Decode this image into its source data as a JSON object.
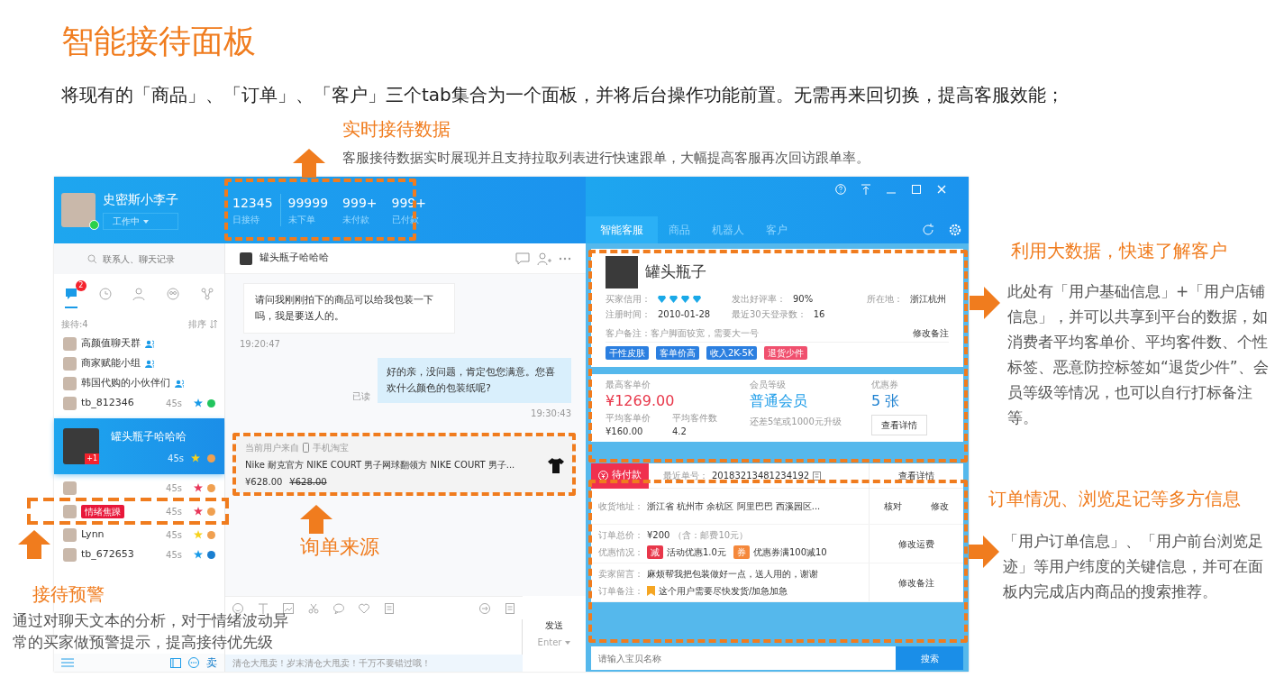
{
  "slide": {
    "title": "智能接待面板",
    "subtitle": "将现有的「商品」、「订单」、「客户」三个tab集合为一个面板，并将后台操作功能前置。无需再来回切换，提高客服效能；"
  },
  "annotations": [
    {
      "kind": "up",
      "heading": "实时接待数据",
      "text": "客服接待数据实时展现并且支持拉取列表进行快速跟单，大幅提高客服再次回访跟单率。"
    },
    {
      "kind": "right",
      "heading": "利用大数据，快速了解客户",
      "text": "此处有「用户基础信息」+「用户店铺信息」，并可以共享到平台的数据，如消费者平均客单价、平均客件数、个性标签、恶意防控标签如“退货少件”、会员等级等情况，也可以自行打标备注等。"
    },
    {
      "kind": "up",
      "heading": "接待预警",
      "text": "通过对聊天文本的分析，对于情绪波动异常的买家做预警提示，提高接待优先级"
    },
    {
      "kind": "up",
      "heading": "询单来源"
    },
    {
      "kind": "right",
      "heading": "订单情况、浏览足记等多方信息",
      "text": "「用户订单信息」、「用户前台浏览足迹」等用户纬度的关键信息，并可在面板内完成店内商品的搜索推荐。"
    }
  ],
  "agent": {
    "name": "史密斯小李子",
    "status": "工作中",
    "online": true
  },
  "stats": [
    {
      "value": "12345",
      "label": "日接待"
    },
    {
      "value": "99999",
      "label": "未下单"
    },
    {
      "value": "999+",
      "label": "未付款"
    },
    {
      "value": "999+",
      "label": "已付款"
    }
  ],
  "search": {
    "placeholder": "联系人、聊天记录"
  },
  "nav": [
    {
      "kind": "chat",
      "selected": true,
      "badge": "2"
    },
    {
      "kind": "recent",
      "selected": false
    },
    {
      "kind": "contact",
      "selected": false
    },
    {
      "kind": "group",
      "selected": false
    },
    {
      "kind": "share",
      "selected": false
    }
  ],
  "list_header": {
    "count": "接待:4",
    "sort": "排序"
  },
  "contacts": [
    {
      "kind": "group",
      "name": "高颜值聊天群",
      "selected": false
    },
    {
      "kind": "group",
      "name": "商家赋能小组",
      "selected": false
    },
    {
      "kind": "group",
      "name": "韩国代购的小伙伴们",
      "selected": false
    },
    {
      "kind": "person",
      "name": "tb_812346",
      "time": "45s",
      "star": {
        "color": "#1a9be8"
      },
      "status": {
        "color": "#22c55e"
      },
      "selected": false
    },
    {
      "kind": "person",
      "name": "罐头瓶子哈哈哈",
      "badge": "+1",
      "time": "45s",
      "star": {
        "color": "#f7d21c"
      },
      "status": {
        "color": "#f0a050"
      },
      "selected": true
    },
    {
      "kind": "person",
      "time": "45s",
      "star": {
        "color": "#e8375a"
      },
      "status": {
        "color": "#f0a050"
      },
      "selected": false
    },
    {
      "kind": "person",
      "tag": "情绪焦躁",
      "time": "45s",
      "star": {
        "color": "#e8375a"
      },
      "status": {
        "color": "#f0a050"
      },
      "selected": false
    },
    {
      "kind": "person",
      "name": "Lynn",
      "time": "45s",
      "star": {
        "color": "#f7d21c"
      },
      "status": {
        "color": "#f0a050"
      },
      "selected": false
    },
    {
      "kind": "person",
      "name": "tb_672653",
      "time": "45s",
      "star": {
        "color": "#1a9be8"
      },
      "status": {
        "color": "#1a7fd0"
      },
      "selected": false
    }
  ],
  "chat": {
    "name": "罐头瓶子哈哈哈",
    "messages": [
      {
        "kind": "incoming",
        "text": "请问我刚刚拍下的商品可以给我包装一下吗，我是要送人的。",
        "time": "19:20:47"
      },
      {
        "kind": "outgoing",
        "text": "好的亲，没问题，肯定包您满意。您喜欢什么颜色的包装纸呢?",
        "status": "已读",
        "time": "19:30:43"
      }
    ],
    "source": {
      "label": "当前用户来自",
      "channel": "手机淘宝",
      "product": "Nike 耐克官方 NIKE COURT 男子网球翻领方 NIKE COURT 男子...",
      "price": "¥628.00",
      "old_price": "¥628.00"
    },
    "send": "发送",
    "send_key": "Enter",
    "ticker": "清仓大甩卖！岁末清仓大甩卖！千万不要错过哦！"
  },
  "left_footer": {
    "shop": "卖"
  },
  "tabs": [
    {
      "label": "智能客服",
      "selected": true
    },
    {
      "label": "商品",
      "selected": false
    },
    {
      "label": "机器人",
      "selected": false
    },
    {
      "label": "客户",
      "selected": false
    }
  ],
  "customer": {
    "name": "罐头瓶子",
    "fields": [
      {
        "label": "买家信用：",
        "stars": 4
      },
      {
        "label": "发出好评率：",
        "value": "90%"
      },
      {
        "label": "所在地：",
        "value": "浙江杭州"
      },
      {
        "label": "注册时间：",
        "value": "2010-01-28"
      },
      {
        "label": "最近30天登录数：",
        "value": "16"
      }
    ],
    "note": "客户备注：客户脚面较宽，需要大一号",
    "note_button": "修改备注",
    "tags": [
      {
        "text": "干性皮肤",
        "color": "#2b7fe0"
      },
      {
        "text": "客单价高",
        "color": "#2b7fe0"
      },
      {
        "text": "收入2K-5K",
        "color": "#2b7fe0"
      },
      {
        "text": "退货少件",
        "color": "#f0506e"
      }
    ]
  },
  "metrics": [
    {
      "label": "最高客单价",
      "value": "¥1269.00",
      "color": "#e8374a",
      "sub": [
        {
          "label": "平均客单价",
          "value": "¥160.00"
        },
        {
          "label": "平均客件数",
          "value": "4.2"
        }
      ]
    },
    {
      "label": "会员等级",
      "value": "普通会员",
      "color": "#1a9be8",
      "note": "还差5笔或1000元升级"
    },
    {
      "label": "优惠券",
      "value": "5 张",
      "color": "#1a7fd0",
      "button": "查看详情"
    }
  ],
  "order": {
    "status": "待付款",
    "number_label": "最近单号：",
    "number": "20183213481234192",
    "action": "查看详情",
    "rows": [
      {
        "lines": [
          {
            "kind": "text",
            "label": "收货地址：",
            "value": "浙江省 杭州市 余杭区 阿里巴巴 西溪园区..."
          }
        ],
        "actions": [
          "核对",
          "修改"
        ]
      },
      {
        "lines": [
          {
            "kind": "text",
            "label": "订单总价：",
            "value": "¥200",
            "extra": "（含：邮费10元）"
          },
          {
            "kind": "promos",
            "label": "优惠情况：",
            "promos": [
              {
                "badge": "减",
                "text": "活动优惠1.0元",
                "color": "#e8374a"
              },
              {
                "badge": "券",
                "text": "优惠券满100减10",
                "color": "#f5883b"
              }
            ]
          }
        ],
        "actions": [
          "修改运费"
        ]
      },
      {
        "lines": [
          {
            "kind": "text",
            "label": "卖家留言：",
            "value": "麻烦帮我把包装做好一点，送人用的，谢谢"
          },
          {
            "kind": "flag",
            "label": "订单备注：",
            "value": "这个用户需要尽快发货/加急加急",
            "color": "#f5a623"
          }
        ],
        "actions": [
          "修改备注"
        ]
      }
    ]
  },
  "product_search": {
    "placeholder": "请输入宝贝名称",
    "button": "搜索"
  }
}
